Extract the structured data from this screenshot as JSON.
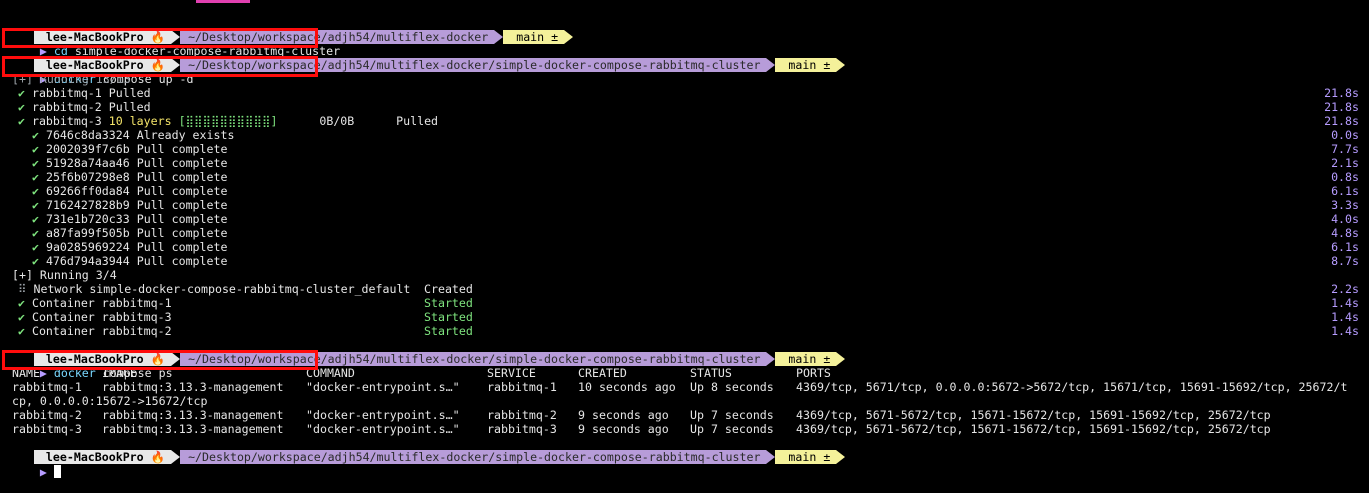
{
  "prompt": {
    "host": "lee-MacBookPro",
    "host_emoji": "🔥",
    "path_root": "~/Desktop/workspace/adjh54/multiflex-docker",
    "path_cluster": "~/Desktop/workspace/adjh54/multiflex-docker/simple-docker-compose-rabbitmq-cluster",
    "git_branch": " main ±",
    "caret": "▶"
  },
  "commands": {
    "cd_cmd": "cd",
    "cd_arg": "simple-docker-compose-rabbitmq-cluster",
    "up_cmd": "docker",
    "up_arg": "compose up -d",
    "ps_cmd": "docker",
    "ps_arg": "compose ps"
  },
  "pull": {
    "header": "[+] Running 13/13",
    "items": [
      {
        "name": "rabbitmq-1 Pulled",
        "time": "21.8s"
      },
      {
        "name": "rabbitmq-2 Pulled",
        "time": "21.8s"
      },
      {
        "name": "rabbitmq-3",
        "layers": "10 layers",
        "bar": "[⣿⣿⣿⣿⣿⣿⣿⣿⣿⣿]",
        "size": "0B/0B",
        "status": "Pulled",
        "time": "21.8s"
      }
    ],
    "layers": [
      {
        "id": "7646c8da3324",
        "status": "Already exists",
        "time": "0.0s"
      },
      {
        "id": "2002039f7c6b",
        "status": "Pull complete",
        "time": "7.7s"
      },
      {
        "id": "51928a74aa46",
        "status": "Pull complete",
        "time": "2.1s"
      },
      {
        "id": "25f6b07298e8",
        "status": "Pull complete",
        "time": "0.8s"
      },
      {
        "id": "69266ff0da84",
        "status": "Pull complete",
        "time": "6.1s"
      },
      {
        "id": "7162427828b9",
        "status": "Pull complete",
        "time": "3.3s"
      },
      {
        "id": "731e1b720c33",
        "status": "Pull complete",
        "time": "4.0s"
      },
      {
        "id": "a87fa99f505b",
        "status": "Pull complete",
        "time": "4.8s"
      },
      {
        "id": "9a0285969224",
        "status": "Pull complete",
        "time": "6.1s"
      },
      {
        "id": "476d794a3944",
        "status": "Pull complete",
        "time": "8.7s"
      }
    ]
  },
  "run": {
    "header": "[+] Running 3/4",
    "items": [
      {
        "mark": "⠿",
        "name": "Network simple-docker-compose-rabbitmq-cluster_default",
        "status": "Created",
        "time": "2.2s"
      },
      {
        "mark": "✔",
        "name": "Container rabbitmq-1",
        "status": "Started",
        "time": "1.4s"
      },
      {
        "mark": "✔",
        "name": "Container rabbitmq-3",
        "status": "Started",
        "time": "1.4s"
      },
      {
        "mark": "✔",
        "name": "Container rabbitmq-2",
        "status": "Started",
        "time": "1.4s"
      }
    ]
  },
  "ps": {
    "headers": [
      "NAME",
      "IMAGE",
      "COMMAND",
      "SERVICE",
      "CREATED",
      "STATUS",
      "PORTS"
    ],
    "rows": [
      [
        "rabbitmq-1",
        "rabbitmq:3.13.3-management",
        "\"docker-entrypoint.s…\"",
        "rabbitmq-1",
        "10 seconds ago",
        "Up 8 seconds",
        "4369/tcp, 5671/tcp, 0.0.0.0:5672->5672/tcp, 15671/tcp, 15691-15692/tcp, 25672/t"
      ],
      [
        "rabbitmq-2",
        "rabbitmq:3.13.3-management",
        "\"docker-entrypoint.s…\"",
        "rabbitmq-2",
        "9 seconds ago",
        "Up 7 seconds",
        "4369/tcp, 5671-5672/tcp, 15671-15672/tcp, 15691-15692/tcp, 25672/tcp"
      ],
      [
        "rabbitmq-3",
        "rabbitmq:3.13.3-management",
        "\"docker-entrypoint.s…\"",
        "rabbitmq-3",
        "9 seconds ago",
        "Up 7 seconds",
        "4369/tcp, 5671-5672/tcp, 15671-15672/tcp, 15691-15692/tcp, 25672/tcp"
      ]
    ],
    "wrap": "cp, 0.0.0.0:15672->15672/tcp"
  },
  "colors": {
    "highlight_box": "#ff0c0c",
    "path_segment": "#b79cd9",
    "git_segment": "#f4f19a",
    "check": "#7ee37e",
    "time": "#b69cff"
  }
}
